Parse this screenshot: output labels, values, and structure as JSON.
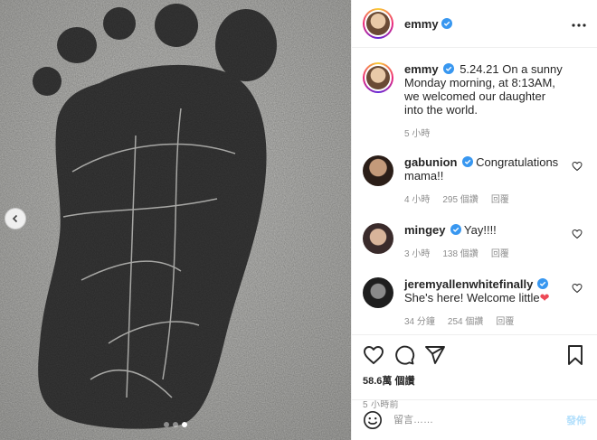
{
  "header": {
    "username": "emmy"
  },
  "caption": {
    "username": "emmy",
    "date": "5.24.21",
    "text": "On a sunny Monday morning, at 8:13AM, we welcomed our daughter into the world.",
    "age": "5 小時"
  },
  "comments": [
    {
      "username": "gabunion",
      "text": "Congratulations mama!!",
      "age": "4 小時",
      "likes": "295 個讚",
      "reply": "回覆"
    },
    {
      "username": "mingey",
      "text": "Yay!!!!",
      "age": "3 小時",
      "likes": "138 個讚",
      "reply": "回覆"
    },
    {
      "username": "jeremyallenwhitefinally",
      "text": "She's here! Welcome little",
      "emoji": "❤",
      "age": "34 分鐘",
      "likes": "254 個讚",
      "reply": "回覆"
    }
  ],
  "likes_text": "58.6萬 個讚",
  "posted_time": "5 小時前",
  "comment_box": {
    "placeholder": "留言……",
    "post_label": "發佈"
  },
  "colors": {
    "verified": "#3897f0",
    "heart": "#ed4956",
    "post_disabled": "#b2dffc"
  },
  "icons": [
    "more-icon",
    "verified-badge-icon",
    "heart-icon",
    "comment-icon",
    "share-icon",
    "save-icon",
    "emoji-icon",
    "chevron-left-icon"
  ]
}
